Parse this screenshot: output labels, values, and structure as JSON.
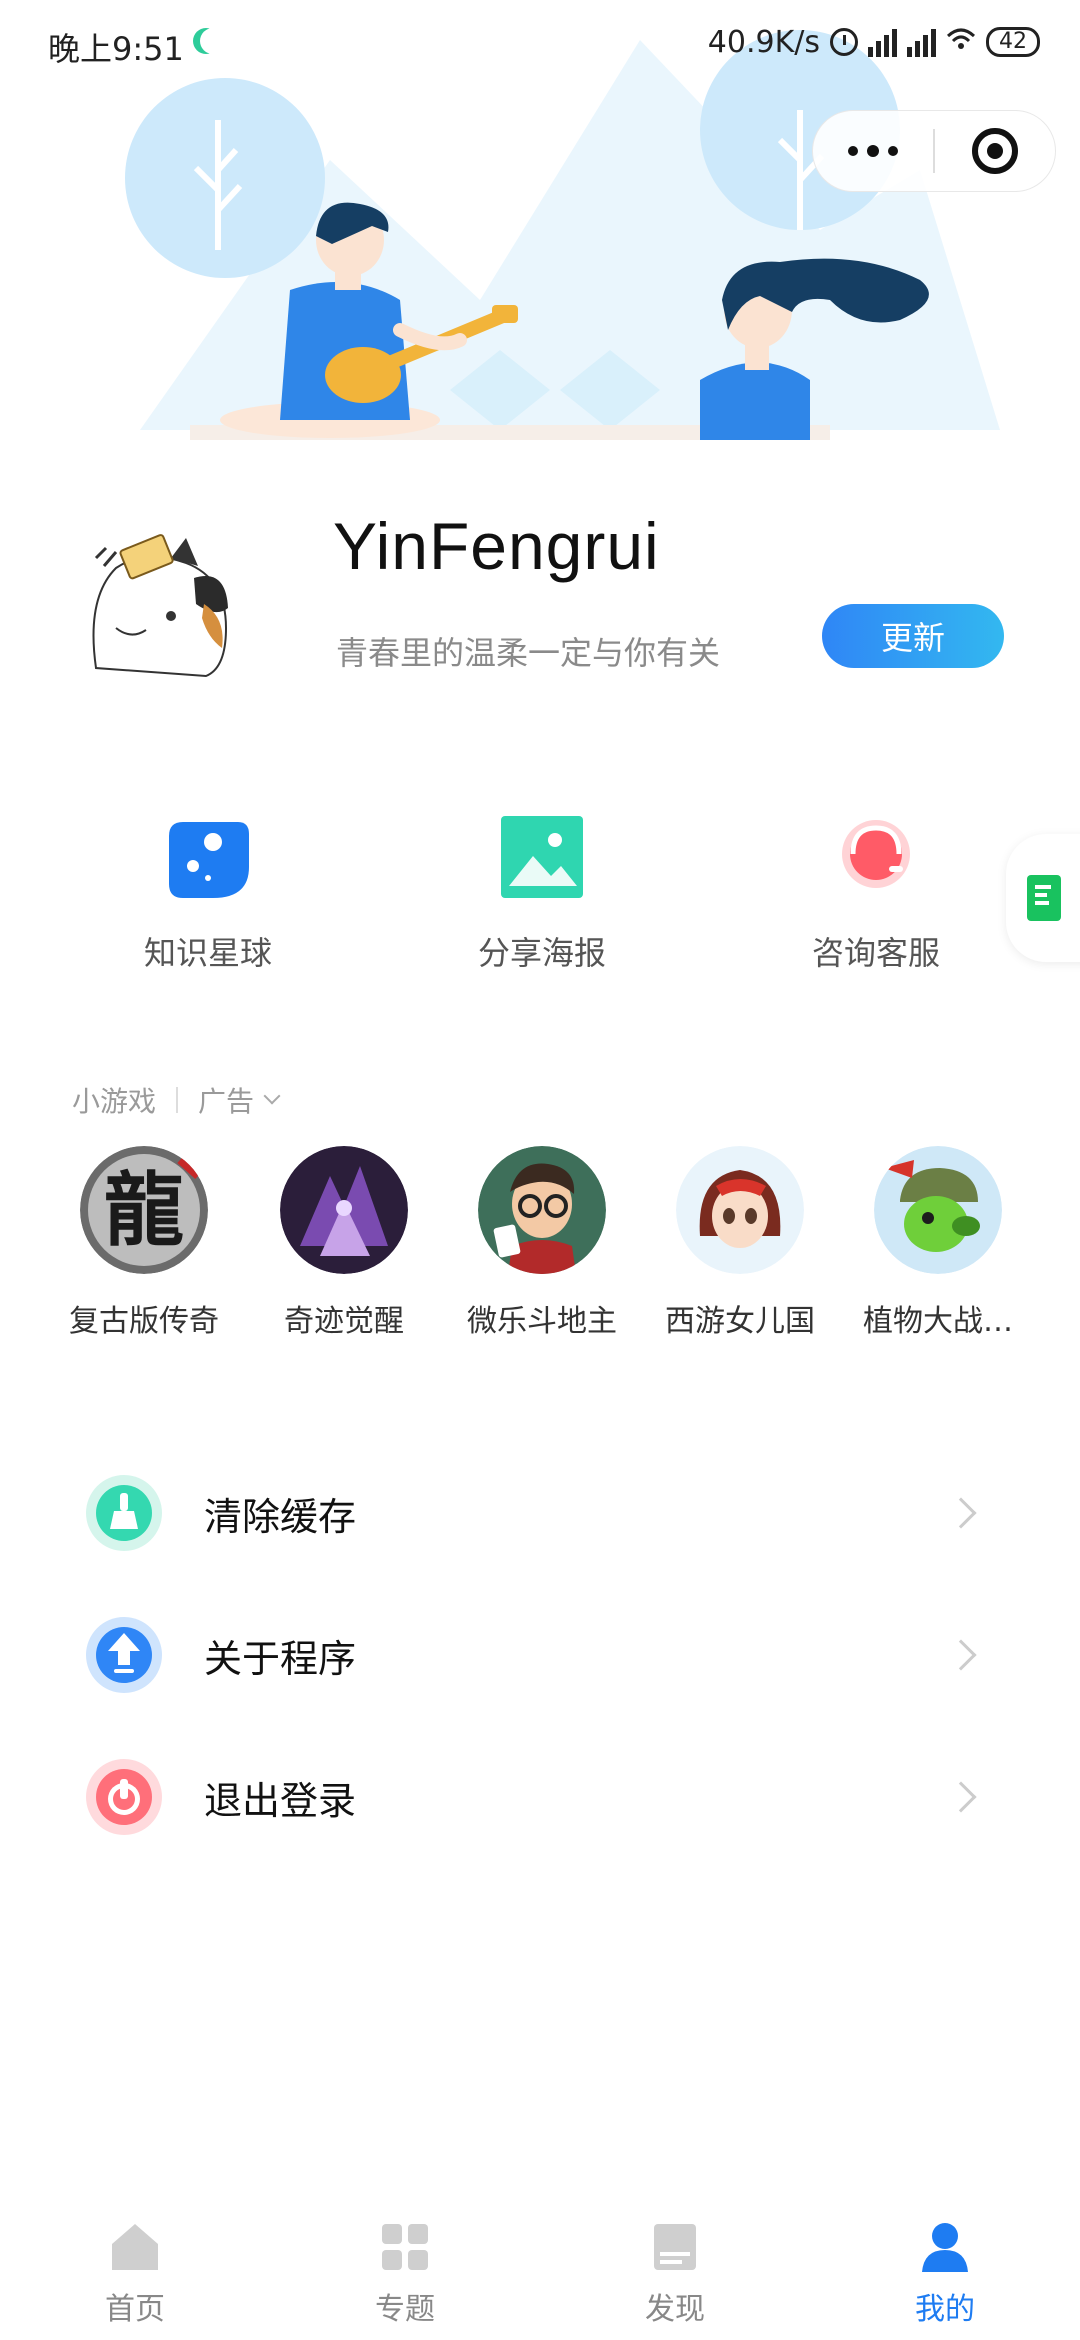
{
  "status_bar": {
    "time": "晚上9:51",
    "network_speed": "40.9K/s",
    "battery": "42"
  },
  "profile": {
    "username": "YinFengrui",
    "motto": "青春里的温柔一定与你有关",
    "update_label": "更新"
  },
  "quick_actions": [
    {
      "label": "知识星球",
      "icon": "planet-icon"
    },
    {
      "label": "分享海报",
      "icon": "image-poster-icon"
    },
    {
      "label": "咨询客服",
      "icon": "headset-icon"
    }
  ],
  "mini_games": {
    "section_label": "小游戏",
    "ad_label": "广告",
    "items": [
      {
        "label": "复古版传奇"
      },
      {
        "label": "奇迹觉醒"
      },
      {
        "label": "微乐斗地主"
      },
      {
        "label": "西游女儿国"
      },
      {
        "label": "植物大战…"
      }
    ]
  },
  "menu": [
    {
      "label": "清除缓存",
      "icon": "broom-icon"
    },
    {
      "label": "关于程序",
      "icon": "upload-arrow-icon"
    },
    {
      "label": "退出登录",
      "icon": "power-icon"
    }
  ],
  "tabbar": {
    "items": [
      {
        "label": "首页",
        "icon": "home-icon"
      },
      {
        "label": "专题",
        "icon": "grid-icon"
      },
      {
        "label": "发现",
        "icon": "document-icon"
      },
      {
        "label": "我的",
        "icon": "user-icon"
      }
    ],
    "active_index": 3
  },
  "colors": {
    "accent": "#1e7cf2",
    "update_gradient_start": "#2f86f6",
    "update_gradient_end": "#33b8f0",
    "subtle_text": "#8a8a8a"
  }
}
